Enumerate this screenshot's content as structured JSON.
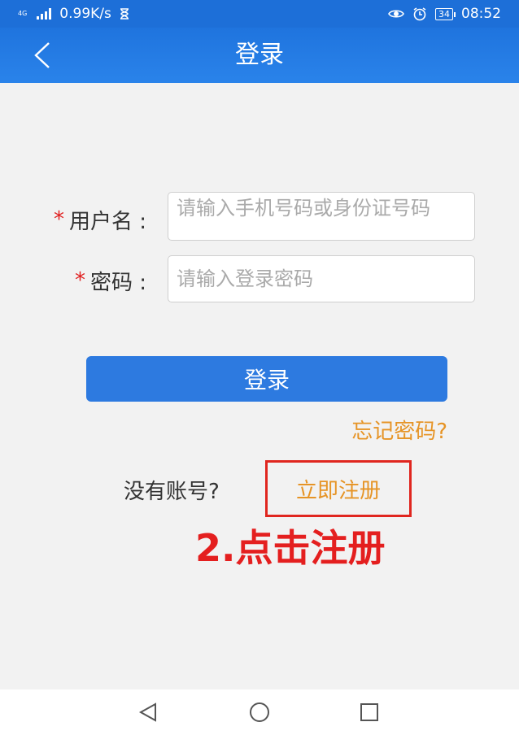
{
  "statusbar": {
    "network_type": "4G",
    "speed": "0.99K/s",
    "battery": "34",
    "time": "08:52"
  },
  "header": {
    "title": "登录"
  },
  "form": {
    "username_required": "*",
    "username_label": "用户名 :",
    "username_placeholder": "请输入手机号码或身份证号码",
    "password_required": "*",
    "password_label": "密码 :",
    "password_placeholder": "请输入登录密码"
  },
  "actions": {
    "login_label": "登录",
    "forgot_label": "忘记密码?",
    "no_account_label": "没有账号?",
    "register_label": "立即注册"
  },
  "annotation": {
    "text": "2.点击注册",
    "color": "#e41f1f"
  },
  "colors": {
    "primary": "#1d6fd8",
    "accent": "#e69426",
    "required": "#e02020"
  }
}
